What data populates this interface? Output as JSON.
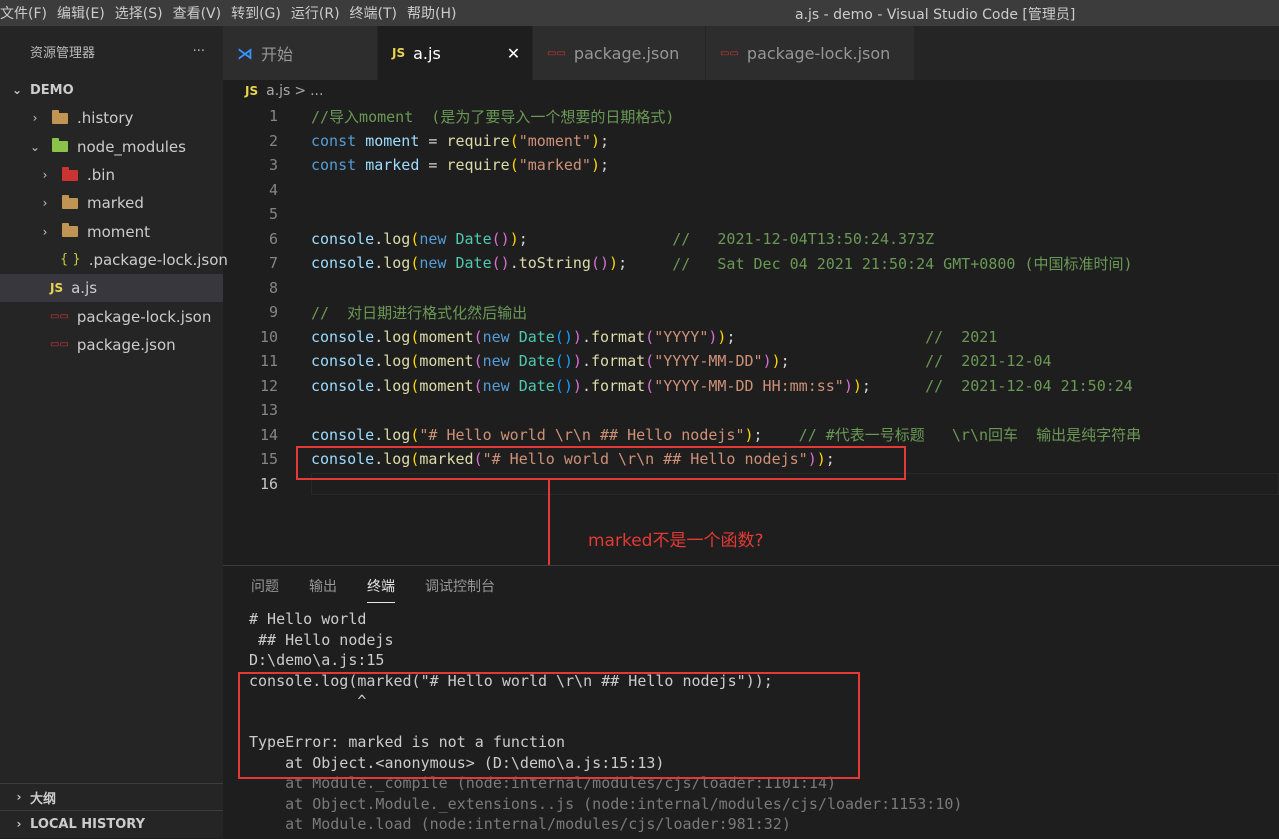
{
  "menubar": {
    "items": [
      "文件(F)",
      "编辑(E)",
      "选择(S)",
      "查看(V)",
      "转到(G)",
      "运行(R)",
      "终端(T)",
      "帮助(H)"
    ],
    "window_title": "a.js - demo - Visual Studio Code [管理员]"
  },
  "sidebar": {
    "title": "资源管理器",
    "more": "···",
    "root": "DEMO",
    "items": [
      {
        "label": ".history"
      },
      {
        "label": "node_modules"
      },
      {
        "label": ".bin"
      },
      {
        "label": "marked"
      },
      {
        "label": "moment"
      },
      {
        "label": ".package-lock.json"
      },
      {
        "label": "a.js"
      },
      {
        "label": "package-lock.json"
      },
      {
        "label": "package.json"
      }
    ],
    "outline": "大纲",
    "local_history": "LOCAL HISTORY"
  },
  "tabs": [
    {
      "label": "开始"
    },
    {
      "label": "a.js",
      "close": "✕"
    },
    {
      "label": "package.json"
    },
    {
      "label": "package-lock.json"
    }
  ],
  "breadcrumb": {
    "file": "a.js",
    "rest": "...",
    "sep": ">"
  },
  "editor": {
    "line_numbers": [
      "1",
      "2",
      "3",
      "4",
      "5",
      "6",
      "7",
      "8",
      "9",
      "10",
      "11",
      "12",
      "13",
      "14",
      "15",
      "16"
    ],
    "line1": "//导入moment  (是为了要导入一个想要的日期格式)",
    "line2": {
      "kw": "const",
      "var": "moment",
      "eq": " = ",
      "fn": "require",
      "arg": "\"moment\""
    },
    "line3": {
      "kw": "const",
      "var": "marked",
      "eq": " = ",
      "fn": "require",
      "arg": "\"marked\""
    },
    "line6_comment": "//   2021-12-04T13:50:24.373Z",
    "line7_comment": "//   Sat Dec 04 2021 21:50:24 GMT+0800 (中国标准时间)",
    "line9": "//  对日期进行格式化然后输出",
    "line10": {
      "fmt": "\"YYYY\"",
      "comment": "//  2021"
    },
    "line11": {
      "fmt": "\"YYYY-MM-DD\"",
      "comment": "//  2021-12-04"
    },
    "line12": {
      "fmt": "\"YYYY-MM-DD HH:mm:ss\"",
      "comment": "//  2021-12-04 21:50:24"
    },
    "line14": {
      "arg": "\"# Hello world \\r\\n ## Hello nodejs\"",
      "comment": "// #代表一号标题   \\r\\n回车  输出是纯字符串"
    },
    "line15": {
      "arg": "\"# Hello world \\r\\n ## Hello nodejs\""
    }
  },
  "annotation": "marked不是一个函数?",
  "panel": {
    "tabs": [
      "问题",
      "输出",
      "终端",
      "调试控制台"
    ],
    "active_tab": "终端",
    "terminal_lines": [
      "# Hello world",
      " ## Hello nodejs",
      "D:\\demo\\a.js:15",
      "console.log(marked(\"# Hello world \\r\\n ## Hello nodejs\"));",
      "            ^",
      "",
      "TypeError: marked is not a function",
      "    at Object.<anonymous> (D:\\demo\\a.js:15:13)",
      "    at Module._compile (node:internal/modules/cjs/loader:1101:14)",
      "    at Object.Module._extensions..js (node:internal/modules/cjs/loader:1153:10)",
      "    at Module.load (node:internal/modules/cjs/loader:981:32)"
    ]
  },
  "colors": {
    "annotation_red": "#e53935",
    "accent_blue": "#3794ff"
  }
}
